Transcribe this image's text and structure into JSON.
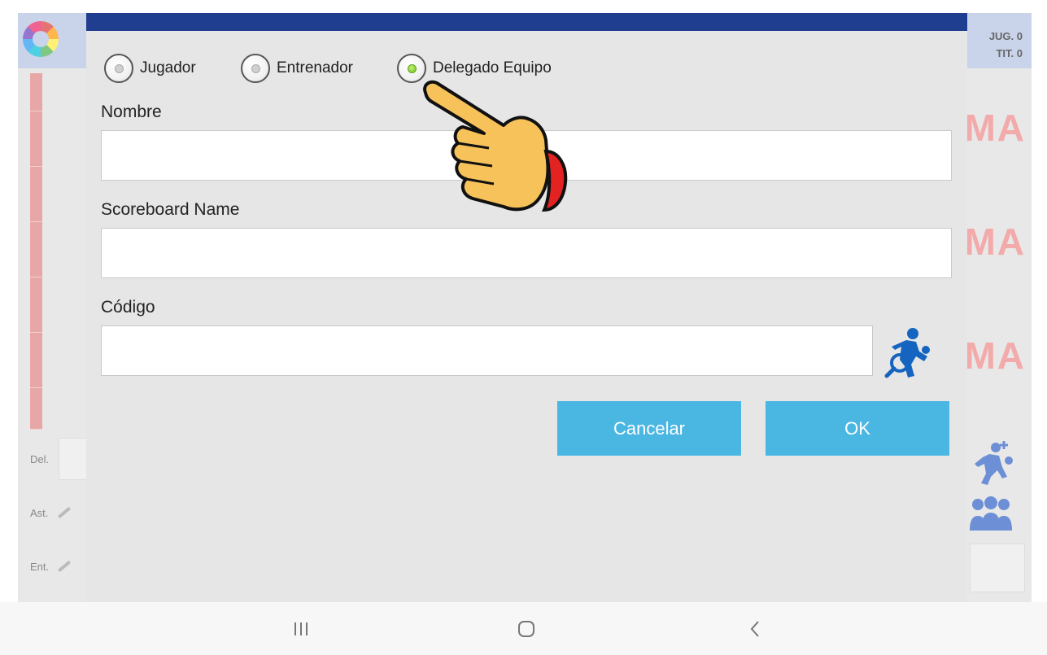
{
  "caption": "",
  "app": {
    "counters": {
      "jug": "JUG. 0",
      "tit": "TIT. 0"
    },
    "side_labels": {
      "del": "Del.",
      "ast": "Ast.",
      "ent": "Ent."
    },
    "watermark": "MA"
  },
  "dialog": {
    "role_options": [
      {
        "label": "Jugador",
        "selected": false
      },
      {
        "label": "Entrenador",
        "selected": false
      },
      {
        "label": "Delegado Equipo",
        "selected": true
      }
    ],
    "fields": {
      "name": {
        "label": "Nombre",
        "value": ""
      },
      "scoreboard": {
        "label": "Scoreboard Name",
        "value": ""
      },
      "code": {
        "label": "Código",
        "value": ""
      }
    },
    "buttons": {
      "cancel": "Cancelar",
      "ok": "OK"
    }
  },
  "colors": {
    "dialog_bar": "#203e8f",
    "button": "#4ab7e3",
    "accent_icon": "#1565c0",
    "selected_radio": "#6cc122"
  },
  "icons": [
    "player-search-icon",
    "add-player-icon",
    "team-icon",
    "pointing-hand-icon",
    "recent-apps-icon",
    "home-icon",
    "back-icon"
  ]
}
